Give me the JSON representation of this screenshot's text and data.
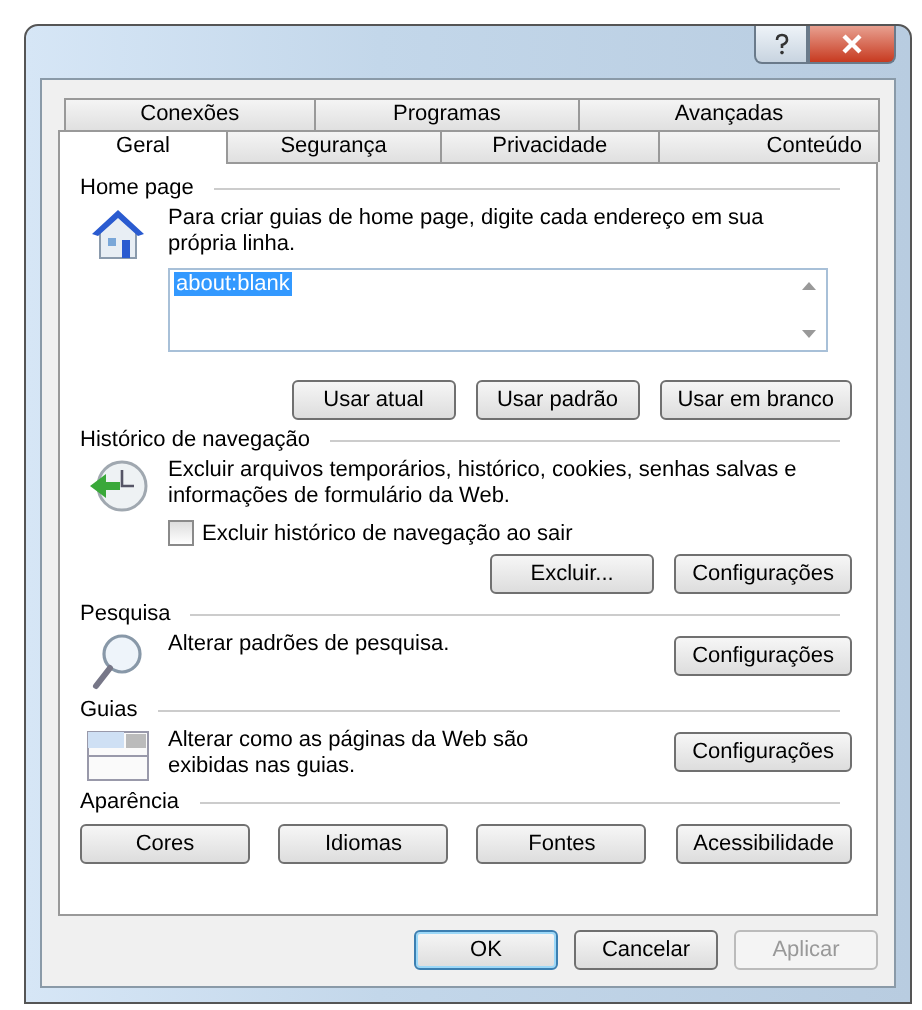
{
  "tabs": {
    "rows": [
      [
        {
          "label": "Conexões",
          "selected": false
        },
        {
          "label": "Programas",
          "selected": false
        },
        {
          "label": "Avançadas",
          "selected": false
        }
      ],
      [
        {
          "label": "Geral",
          "selected": true
        },
        {
          "label": "Segurança",
          "selected": false
        },
        {
          "label": "Privacidade",
          "selected": false
        },
        {
          "label": "Conteúdo",
          "selected": false
        }
      ]
    ]
  },
  "sections": [
    {
      "kind": "home",
      "title": "Home page",
      "description": "Para criar guias de home page, digite cada endereço em sua própria linha.",
      "value": "about:blank",
      "buttons": [
        "Usar atual",
        "Usar padrão",
        "Usar em branco"
      ]
    },
    {
      "kind": "history",
      "title": "Histórico de navegação",
      "description": "Excluir arquivos temporários, histórico, cookies, senhas salvas e informações de formulário da Web.",
      "checkbox": {
        "label": "Excluir histórico de navegação ao sair",
        "checked": false
      },
      "buttons": [
        "Excluir...",
        "Configurações"
      ]
    },
    {
      "kind": "search",
      "title": "Pesquisa",
      "description": "Alterar padrões de pesquisa.",
      "buttons": [
        "Configurações"
      ]
    },
    {
      "kind": "tabs",
      "title": "Guias",
      "description": "Alterar como as páginas da Web são exibidas nas guias.",
      "buttons": [
        "Configurações"
      ]
    },
    {
      "kind": "appearance",
      "title": "Aparência",
      "buttons": [
        "Cores",
        "Idiomas",
        "Fontes",
        "Acessibilidade"
      ]
    }
  ],
  "dialog_buttons": [
    {
      "label": "OK",
      "default": true,
      "disabled": false
    },
    {
      "label": "Cancelar",
      "default": false,
      "disabled": false
    },
    {
      "label": "Aplicar",
      "default": false,
      "disabled": true
    }
  ]
}
